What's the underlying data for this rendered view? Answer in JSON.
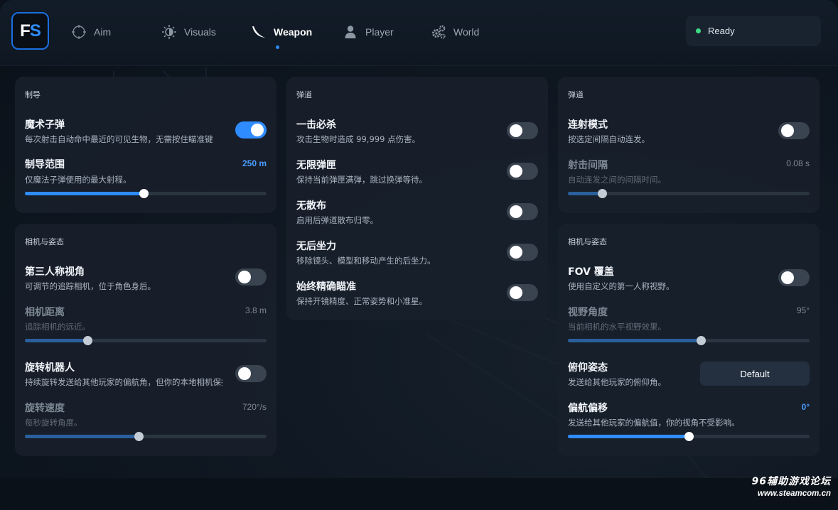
{
  "app": {
    "logo_f": "F",
    "logo_s": "S"
  },
  "nav": [
    {
      "label": "Aim",
      "icon": "crosshair-icon"
    },
    {
      "label": "Visuals",
      "icon": "sun-icon"
    },
    {
      "label": "Weapon",
      "icon": "blade-icon",
      "active": true
    },
    {
      "label": "Player",
      "icon": "person-icon"
    },
    {
      "label": "World",
      "icon": "gears-icon"
    }
  ],
  "status": {
    "label": "Ready",
    "color": "#3ddc84"
  },
  "colors": {
    "accent": "#2f8cff",
    "card": "#18202b",
    "background": "#0e1620"
  },
  "guidance": {
    "title": "制导",
    "magic_bullet": {
      "title": "魔术子弹",
      "desc": "每次射击自动命中最近的可见生物，无需按住瞄准键",
      "on": true
    },
    "range": {
      "title": "制导范围",
      "desc": "仅魔法子弹使用的最大射程。",
      "value": "250 m",
      "level": 0.49
    }
  },
  "camera_left": {
    "title": "相机与姿态",
    "third_person": {
      "title": "第三人称视角",
      "desc": "可调节的追踪相机，位于角色身后。",
      "on": false
    },
    "camera_distance": {
      "title": "相机距离",
      "desc": "追踪相机的远近。",
      "value": "3.8 m",
      "level": 0.26
    },
    "spinbot": {
      "title": "旋转机器人",
      "desc": "持续旋转发送给其他玩家的偏航角，但你的本地相机保持不变。",
      "on": false
    },
    "spin_speed": {
      "title": "旋转速度",
      "desc": "每秒旋转角度。",
      "value": "720°/s",
      "level": 0.47
    }
  },
  "ballistics_mid": {
    "title": "弹道",
    "items": [
      {
        "title": "一击必杀",
        "desc": "攻击生物时造成 99,999 点伤害。",
        "on": false
      },
      {
        "title": "无限弹匣",
        "desc": "保持当前弹匣满弹，跳过换弹等待。",
        "on": false
      },
      {
        "title": "无散布",
        "desc": "启用后弹道散布归零。",
        "on": false
      },
      {
        "title": "无后坐力",
        "desc": "移除镜头、模型和移动产生的后坐力。",
        "on": false
      },
      {
        "title": "始终精确瞄准",
        "desc": "保持开镜精度、正常姿势和小准星。",
        "on": false
      }
    ]
  },
  "ballistics_right": {
    "title": "弹道",
    "auto_fire": {
      "title": "连射模式",
      "desc": "按选定间隔自动连发。",
      "on": false
    },
    "interval": {
      "title": "射击间隔",
      "desc": "自动连发之间的间隔时间。",
      "value": "0.08 s",
      "level": 0.14
    }
  },
  "camera_right": {
    "title": "相机与姿态",
    "fov_override": {
      "title": "FOV 覆盖",
      "desc": "使用自定义的第一人称视野。",
      "on": false
    },
    "fov_angle": {
      "title": "视野角度",
      "desc": "当前相机的水平视野效果。",
      "value": "95°",
      "level": 0.55
    },
    "pitch": {
      "title": "俯仰姿态",
      "desc": "发送给其他玩家的俯仰角。",
      "button": "Default"
    },
    "yaw_offset": {
      "title": "偏航偏移",
      "desc": "发送给其他玩家的偏航值，你的视角不受影响。",
      "value": "0°",
      "level": 0.5
    }
  },
  "watermark": {
    "line1": "96辅助游戏论坛",
    "line2": "www.steamcom.cn"
  }
}
